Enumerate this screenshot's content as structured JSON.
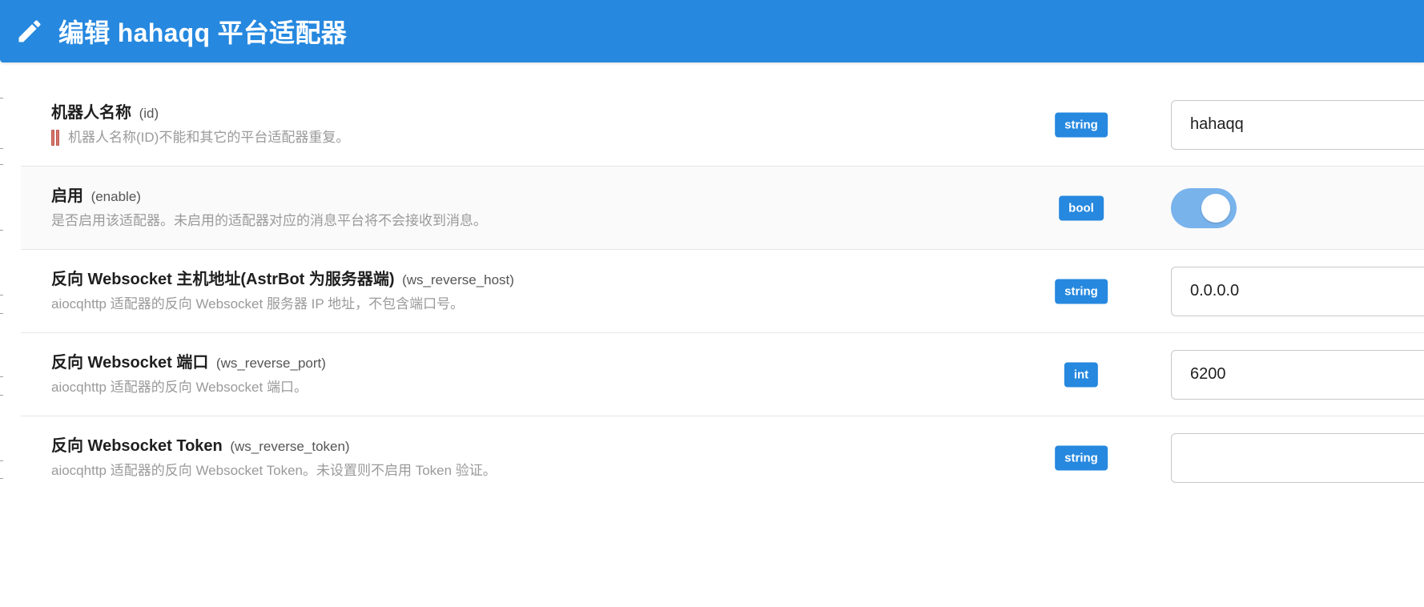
{
  "header": {
    "icon": "pencil-icon",
    "title": "编辑 hahaqq 平台适配器",
    "background": "#2688df"
  },
  "fields": [
    {
      "label": "机器人名称",
      "key": "(id)",
      "description": "机器人名称(ID)不能和其它的平台适配器重复。",
      "description_icon": "warning-icon",
      "type": "string",
      "value": "hahaqq"
    },
    {
      "label": "启用",
      "key": "(enable)",
      "description": "是否启用该适配器。未启用的适配器对应的消息平台将不会接收到消息。",
      "type": "bool",
      "value": true
    },
    {
      "label": "反向 Websocket 主机地址(AstrBot 为服务器端)",
      "key": "(ws_reverse_host)",
      "description": "aiocqhttp 适配器的反向 Websocket 服务器 IP 地址，不包含端口号。",
      "type": "string",
      "value": "0.0.0.0"
    },
    {
      "label": "反向 Websocket 端口",
      "key": "(ws_reverse_port)",
      "description": "aiocqhttp 适配器的反向 Websocket 端口。",
      "type": "int",
      "value": "6200"
    },
    {
      "label": "反向 Websocket Token",
      "key": "(ws_reverse_token)",
      "description": "aiocqhttp 适配器的反向 Websocket Token。未设置则不启用 Token 验证。",
      "type": "string",
      "value": ""
    }
  ],
  "colors": {
    "accent": "#2688df",
    "toggle_on": "#79b3ec"
  }
}
